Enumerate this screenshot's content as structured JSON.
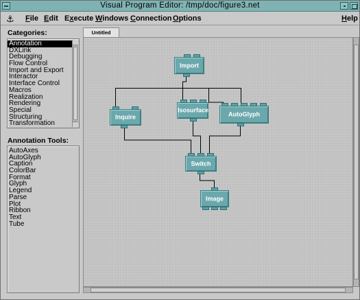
{
  "window": {
    "title": "Visual Program Editor: /tmp/doc/figure3.net"
  },
  "menubar": {
    "items": [
      {
        "label": "File",
        "mnemonic": "F",
        "rest": "ile"
      },
      {
        "label": "Edit",
        "mnemonic": "E",
        "rest": "dit"
      },
      {
        "label": "Execute",
        "mnemonic": "x",
        "pre": "E",
        "rest": "ecute"
      },
      {
        "label": "Windows",
        "mnemonic": "W",
        "rest": "indows"
      },
      {
        "label": "Connection",
        "mnemonic": "C",
        "rest": "onnection"
      },
      {
        "label": "Options",
        "mnemonic": "O",
        "rest": "ptions"
      },
      {
        "label": "Help",
        "mnemonic": "H",
        "rest": "elp"
      }
    ]
  },
  "categories": {
    "label": "Categories:",
    "items": [
      "Annotation",
      "DXLink",
      "Debugging",
      "Flow Control",
      "Import and Export",
      "Interactor",
      "Interface Control",
      "Macros",
      "Realization",
      "Rendering",
      "Special",
      "Structuring",
      "Transformation"
    ],
    "selected": "Annotation"
  },
  "tools": {
    "label": "Annotation Tools:",
    "items": [
      "AutoAxes",
      "AutoGlyph",
      "Caption",
      "ColorBar",
      "Format",
      "Glyph",
      "Legend",
      "Parse",
      "Plot",
      "Ribbon",
      "Text",
      "Tube"
    ]
  },
  "canvas": {
    "tab_label": "Untitled",
    "nodes": {
      "import": "Import",
      "inquire": "Inquire",
      "isosurface": "Isosurface",
      "autoglyph": "AutoGlyph",
      "switch": "Switch",
      "image": "Image"
    }
  },
  "icons": {
    "window_menu": "window-menu-icon",
    "minimize": "minimize-icon",
    "maximize": "maximize-icon",
    "anchor": "anchor-icon"
  }
}
